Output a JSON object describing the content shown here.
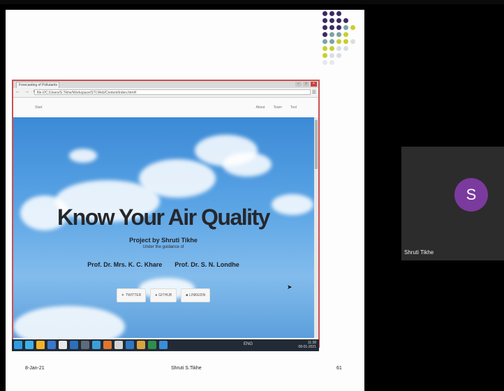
{
  "browser": {
    "tab_title": "Forecasting of Pollutants",
    "url": "file:///C:/Users/S.Tikhe/Workspace/STI.Web/Content/index.html#",
    "nav_glyphs": "← → C",
    "menu_glyph": "☰",
    "window_buttons": [
      "–",
      "□",
      "×"
    ]
  },
  "site": {
    "brand": "Start",
    "nav_links": [
      "About",
      "Team",
      "Tool"
    ],
    "title": "Know Your Air Quality",
    "project_line": "Project by Shruti Tikhe",
    "guidance_line": "Under the guidance of",
    "professors": [
      "Prof. Dr. Mrs. K. C. Khare",
      "Prof. Dr. S. N. Londhe"
    ],
    "buttons": [
      {
        "icon": "twitter-icon",
        "label": "TWITTER"
      },
      {
        "icon": "github-icon",
        "label": "GITHUB"
      },
      {
        "icon": "linkedin-icon",
        "label": "LINKEDIN"
      }
    ]
  },
  "taskbar": {
    "tray_text": "ENG",
    "clock_time": "11:38",
    "clock_date": "08-01-2021"
  },
  "slide": {
    "date": "8-Jan-21",
    "presenter": "Shruti S.Tikhe",
    "page_number": "61"
  },
  "participant": {
    "initial": "S",
    "name": "Shruti Tikhe"
  },
  "colors": {
    "avatar": "#7b3a9e",
    "browser_border": "#c95050",
    "sky": "#4f9be0",
    "dot_purple": "#3a2a63",
    "dot_teal": "#7da3a6",
    "dot_lime": "#c7cf2e"
  }
}
